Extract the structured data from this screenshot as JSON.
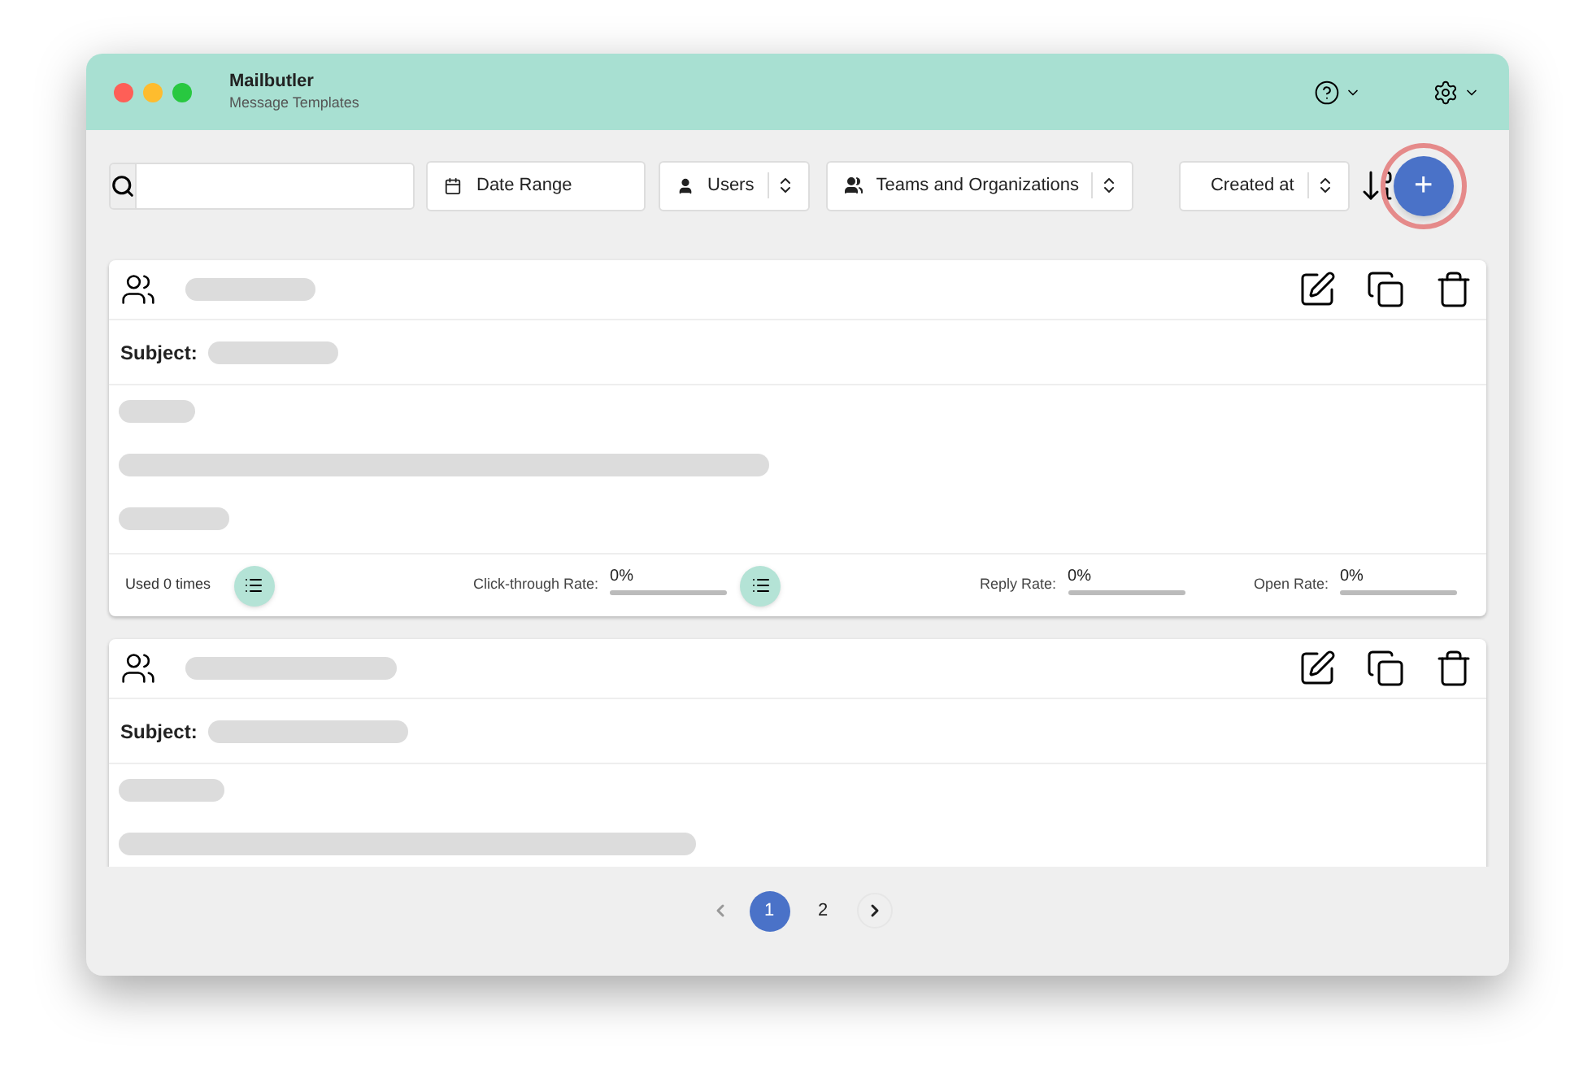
{
  "window": {
    "title": "Mailbutler",
    "subtitle": "Message Templates"
  },
  "toolbar": {
    "date_range": "Date Range",
    "users": "Users",
    "teams": "Teams and Organizations",
    "sort": "Created at",
    "add_button": {
      "label": "+",
      "highlighted": true
    }
  },
  "templates": [
    {
      "subject_label": "Subject:",
      "footer": [
        {
          "kind": "count",
          "text": "Used 0 times"
        },
        {
          "kind": "list_button"
        },
        {
          "kind": "rate",
          "label": "Click-through Rate:",
          "value": "0%",
          "level": 0
        },
        {
          "kind": "list_button"
        },
        {
          "kind": "rate",
          "label": "Reply Rate:",
          "value": "0%",
          "level": 0
        },
        {
          "kind": "rate",
          "label": "Open Rate:",
          "value": "0%",
          "level": 0
        }
      ]
    },
    {
      "subject_label": "Subject:"
    }
  ],
  "pagination": {
    "previous": {
      "disabled": true
    },
    "pages": [
      {
        "label": "1",
        "selected": true
      },
      {
        "label": "2",
        "selected": false
      }
    ],
    "next": {
      "disabled": false
    }
  }
}
